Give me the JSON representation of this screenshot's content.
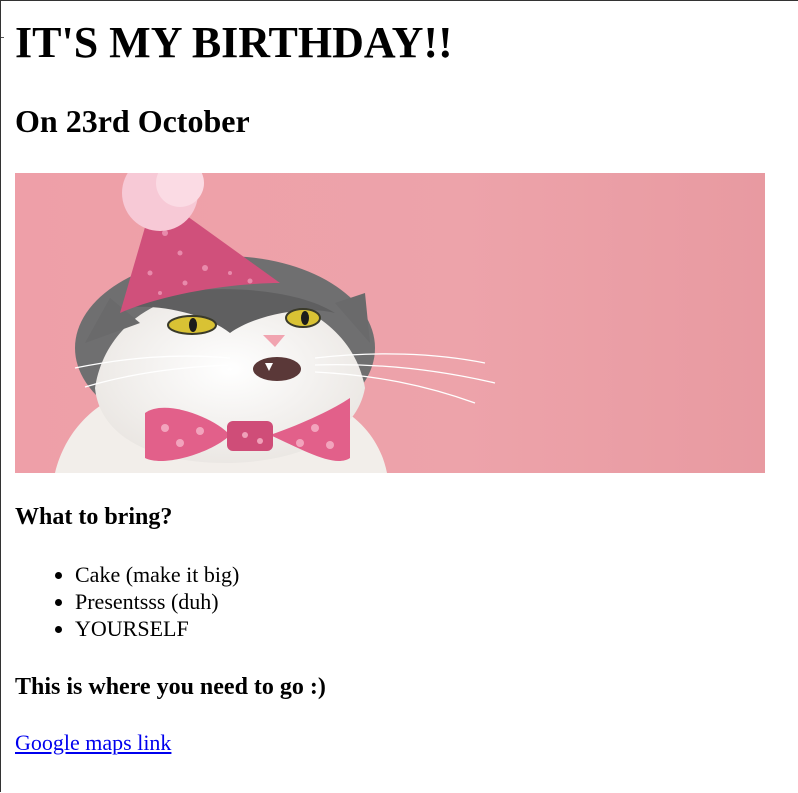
{
  "page": {
    "title": "IT'S MY BIRTHDAY!!",
    "date_heading": "On 23rd October"
  },
  "hero_image": {
    "alt": "cat-in-party-hat",
    "colors": {
      "background": "#e99aa2",
      "hat": "#d2507a",
      "pompom": "#f6c6d4",
      "bowtie": "#e2608a",
      "cat_white": "#f4f1ee",
      "cat_gray": "#6b6b6b",
      "eyes": "#d9c234"
    }
  },
  "bring_section": {
    "heading": "What to bring?",
    "items": [
      "Cake (make it big)",
      "Presentsss (duh)",
      "YOURSELF"
    ]
  },
  "location_section": {
    "heading": "This is where you need to go :)",
    "link_label": "Google maps link"
  },
  "link_color": "#0000ee"
}
